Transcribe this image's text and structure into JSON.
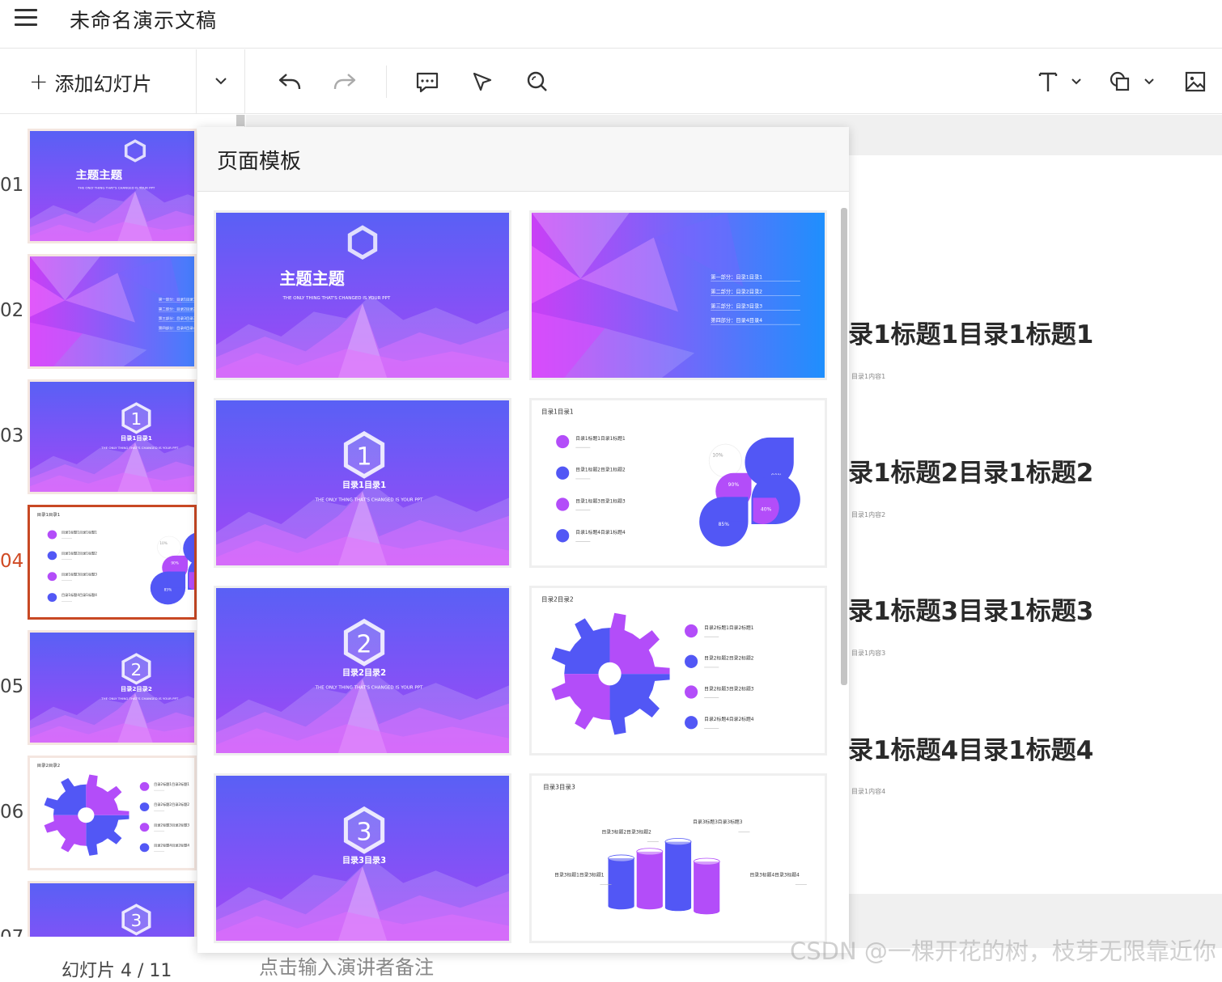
{
  "title_bar": {
    "doc_title": "未命名演示文稿"
  },
  "toolbar": {
    "add_slide_label": "添加幻灯片"
  },
  "colors": {
    "accent_red": "#c84824",
    "theme_blue": "#5a5cf6",
    "theme_purple": "#b24dfa",
    "theme_cyan": "#1e90ff"
  },
  "thumbnails": {
    "items": [
      {
        "num": "01",
        "kind": "cover",
        "title": "主题主题",
        "subtitle": "THE ONLY THING THAT'S CHANGED IS YOUR PPT"
      },
      {
        "num": "02",
        "kind": "toc",
        "lines": [
          "第一部分：目录1目录1",
          "第二部分：目录2目录2",
          "第三部分：目录3目录3",
          "第四部分：目录4目录4"
        ]
      },
      {
        "num": "03",
        "kind": "section",
        "badge": "1",
        "title": "目录1目录1",
        "subtitle": "THE ONLY THING THAT'S CHANGED IS YOUR PPT"
      },
      {
        "num": "04",
        "kind": "petal",
        "active": true,
        "heading": "目录1目录1",
        "items": [
          "目录1标题1目录1标题1",
          "目录1标题2目录1标题2",
          "目录1标题3目录1标题3",
          "目录1标题4目录1标题4"
        ],
        "percents": [
          "10%",
          "90%",
          "90%",
          "85%",
          "40%"
        ]
      },
      {
        "num": "05",
        "kind": "section",
        "badge": "2",
        "title": "目录2目录2",
        "subtitle": "THE ONLY THING THAT'S CHANGED IS YOUR PPT"
      },
      {
        "num": "06",
        "kind": "gear",
        "heading": "目录2目录2",
        "items": [
          "目录2标题1目录2标题1",
          "目录2标题2目录2标题2",
          "目录2标题3目录2标题3",
          "目录2标题4目录2标题4"
        ]
      },
      {
        "num": "07",
        "kind": "section",
        "badge": "3"
      }
    ]
  },
  "status": {
    "slide_counter": "幻灯片 4 / 11",
    "notes_placeholder": "点击输入演讲者备注"
  },
  "canvas": {
    "items": [
      {
        "title": "录1标题1目录1标题1",
        "sub": "目录1内容1"
      },
      {
        "title": "录1标题2目录1标题2",
        "sub": "目录1内容2"
      },
      {
        "title": "录1标题3目录1标题3",
        "sub": "目录1内容3"
      },
      {
        "title": "录1标题4目录1标题4",
        "sub": "目录1内容4"
      }
    ]
  },
  "template_panel": {
    "title": "页面模板",
    "cards": [
      {
        "kind": "cover",
        "title": "主题主题",
        "subtitle": "THE ONLY THING THAT'S CHANGED IS YOUR PPT"
      },
      {
        "kind": "toc",
        "lines": [
          "第一部分：目录1目录1",
          "第二部分：目录2目录2",
          "第三部分：目录3目录3",
          "第四部分：目录4目录4"
        ]
      },
      {
        "kind": "section",
        "badge": "1",
        "title": "目录1目录1",
        "subtitle": "THE ONLY THING THAT'S CHANGED IS YOUR PPT"
      },
      {
        "kind": "petal",
        "heading": "目录1目录1",
        "items": [
          "目录1标题1目录1标题1",
          "目录1标题2目录1标题2",
          "目录1标题3目录1标题3",
          "目录1标题4目录1标题4"
        ],
        "percents": [
          "10%",
          "90%",
          "90%",
          "85%",
          "40%"
        ]
      },
      {
        "kind": "section",
        "badge": "2",
        "title": "目录2目录2",
        "subtitle": "THE ONLY THING THAT'S CHANGED IS YOUR PPT"
      },
      {
        "kind": "gear",
        "heading": "目录2目录2",
        "items": [
          "目录2标题1目录2标题1",
          "目录2标题2目录2标题2",
          "目录2标题3目录2标题3",
          "目录2标题4目录2标题4"
        ]
      },
      {
        "kind": "section",
        "badge": "3",
        "title": "目录3目录3",
        "subtitle": ""
      },
      {
        "kind": "cylinders",
        "heading": "目录3目录3",
        "items": [
          "目录3标题1目录3标题1",
          "目录3标题2目录3标题2",
          "目录3标题3目录3标题3",
          "目录3标题4目录3标题4"
        ]
      }
    ]
  },
  "watermark": "CSDN @一棵开花的树，枝芽无限靠近你"
}
